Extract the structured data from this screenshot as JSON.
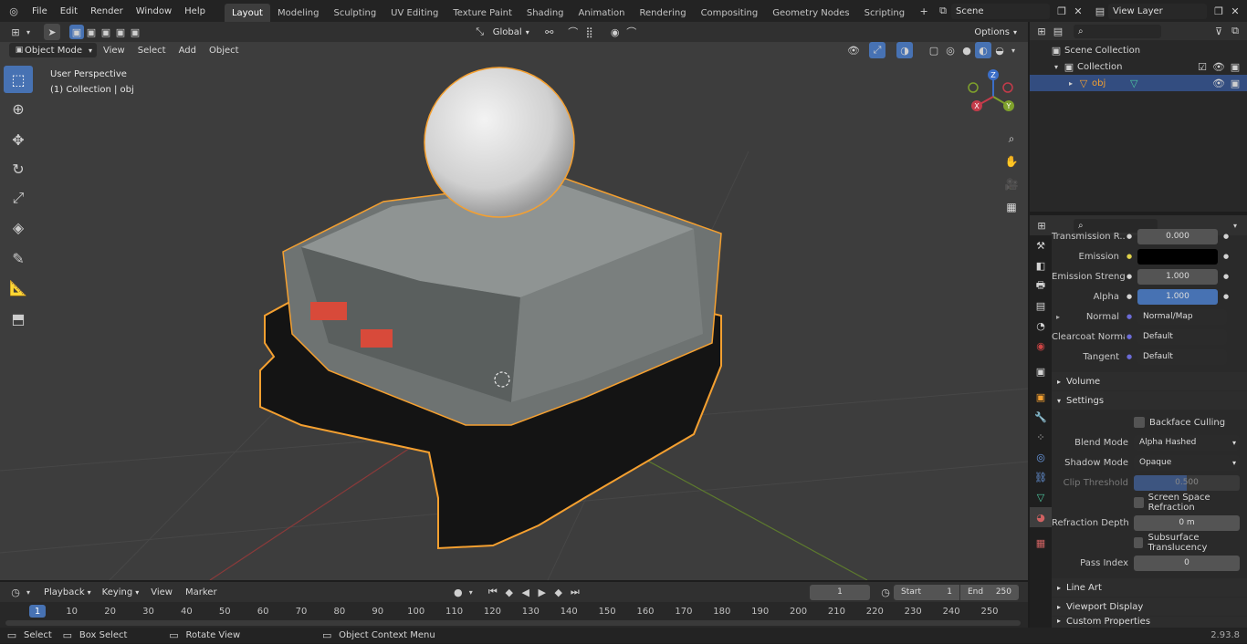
{
  "topbar": {
    "menus": [
      "File",
      "Edit",
      "Render",
      "Window",
      "Help"
    ],
    "workspaces": [
      "Layout",
      "Modeling",
      "Sculpting",
      "UV Editing",
      "Texture Paint",
      "Shading",
      "Animation",
      "Rendering",
      "Compositing",
      "Geometry Nodes",
      "Scripting"
    ],
    "active_workspace": "Layout",
    "scene": "Scene",
    "view_layer": "View Layer"
  },
  "viewport": {
    "mode": "Object Mode",
    "menus": [
      "View",
      "Select",
      "Add",
      "Object"
    ],
    "orientation": "Global",
    "options_label": "Options",
    "perspective_label": "User Perspective",
    "collection_label": "(1) Collection | obj",
    "gizmo_axes": [
      "X",
      "Y",
      "Z"
    ]
  },
  "outliner": {
    "root": "Scene Collection",
    "collection": "Collection",
    "object": "obj"
  },
  "properties": {
    "rows": [
      {
        "label": "Transmission R...",
        "value": "0.000"
      },
      {
        "label": "Emission",
        "value": ""
      },
      {
        "label": "Emission Strengt",
        "value": "1.000"
      },
      {
        "label": "Alpha",
        "value": "1.000"
      },
      {
        "label": "Normal",
        "value": "Normal/Map"
      },
      {
        "label": "Clearcoat Normal",
        "value": "Default"
      },
      {
        "label": "Tangent",
        "value": "Default"
      }
    ],
    "volume_section": "Volume",
    "settings_section": "Settings",
    "backface_culling": "Backface Culling",
    "blend_mode_label": "Blend Mode",
    "blend_mode_value": "Alpha Hashed",
    "shadow_mode_label": "Shadow Mode",
    "shadow_mode_value": "Opaque",
    "clip_threshold_label": "Clip Threshold",
    "clip_threshold_value": "0.500",
    "screen_space_refraction": "Screen Space Refraction",
    "refraction_depth_label": "Refraction Depth",
    "refraction_depth_value": "0 m",
    "subsurface_translucency": "Subsurface Translucency",
    "pass_index_label": "Pass Index",
    "pass_index_value": "0",
    "line_art": "Line Art",
    "viewport_display": "Viewport Display",
    "custom_properties": "Custom Properties"
  },
  "timeline": {
    "menus": [
      "Playback",
      "Keying",
      "View",
      "Marker"
    ],
    "current_frame": "1",
    "start_label": "Start",
    "start_value": "1",
    "end_label": "End",
    "end_value": "250",
    "ticks": [
      "1",
      "10",
      "20",
      "30",
      "40",
      "50",
      "60",
      "70",
      "80",
      "90",
      "100",
      "110",
      "120",
      "130",
      "140",
      "150",
      "160",
      "170",
      "180",
      "190",
      "200",
      "210",
      "220",
      "230",
      "240",
      "250"
    ]
  },
  "statusbar": {
    "select": "Select",
    "box_select": "Box Select",
    "rotate_view": "Rotate View",
    "context_menu": "Object Context Menu",
    "version": "2.93.8"
  },
  "colors": {
    "accent": "#4772b3",
    "selection_outline": "#f5a030",
    "viewport_bg": "#3d3d3d"
  }
}
